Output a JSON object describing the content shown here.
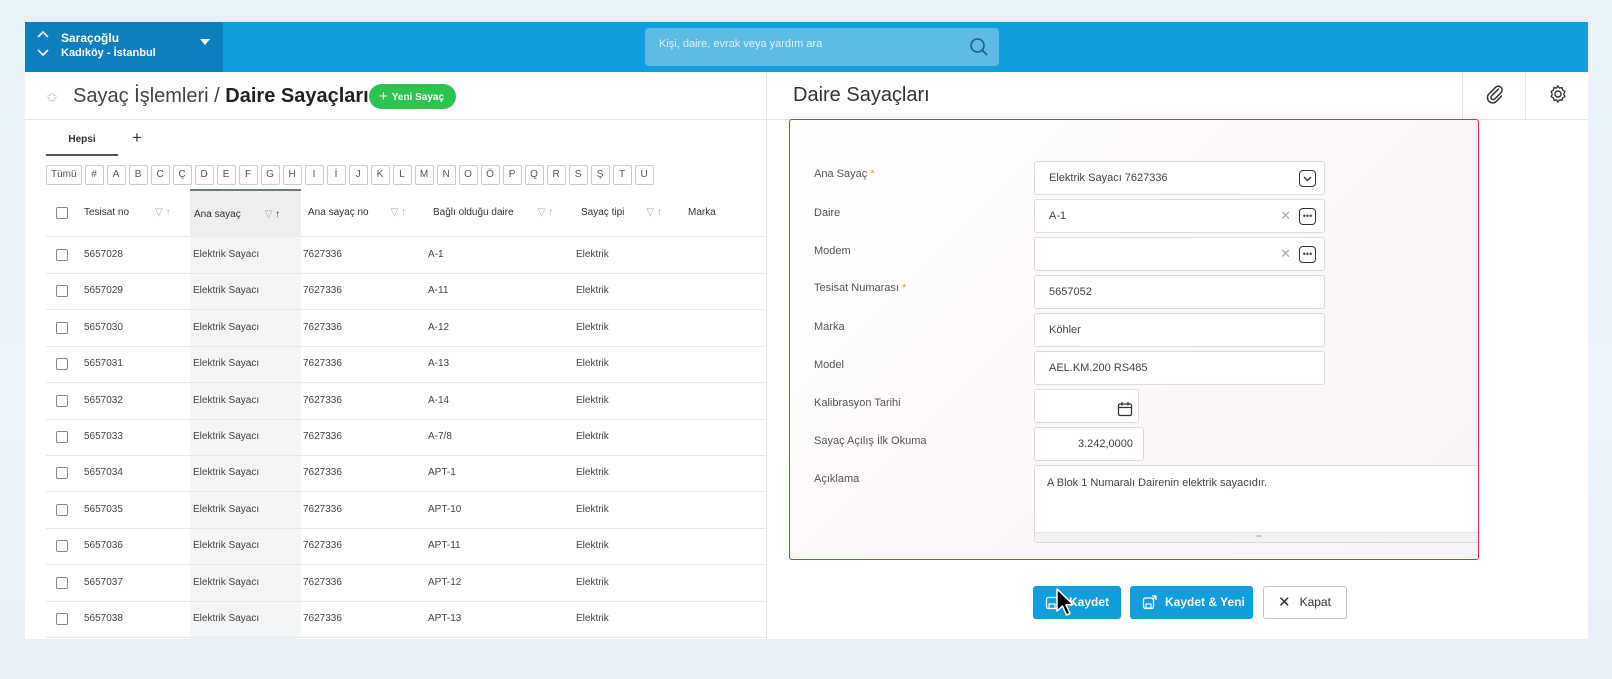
{
  "site": {
    "name": "Saraçoğlu",
    "location": "Kadıköy - İstanbul"
  },
  "search": {
    "placeholder": "Kişi, daire, evrak veya yardım ara"
  },
  "breadcrumb": {
    "parent": "Sayaç İşlemleri /",
    "current": "Daire Sayaçları"
  },
  "new_button": {
    "label": "Yeni Sayaç"
  },
  "tabs": {
    "all": "Hepsi",
    "add": "+"
  },
  "letters": [
    "Tümü",
    "#",
    "A",
    "B",
    "C",
    "Ç",
    "D",
    "E",
    "F",
    "G",
    "H",
    "I",
    "İ",
    "J",
    "K",
    "L",
    "M",
    "N",
    "O",
    "Ö",
    "P",
    "Q",
    "R",
    "S",
    "Ş",
    "T",
    "U"
  ],
  "grid": {
    "columns": [
      "Tesisat no",
      "Ana sayaç",
      "Ana sayaç no",
      "Bağlı olduğu daire",
      "Sayaç tipi",
      "Marka"
    ],
    "rows": [
      {
        "tesisat": "5657028",
        "ana": "Elektrik Sayacı",
        "no": "7627336",
        "daire": "A-1",
        "tip": "Elektrik"
      },
      {
        "tesisat": "5657029",
        "ana": "Elektrik Sayacı",
        "no": "7627336",
        "daire": "A-11",
        "tip": "Elektrik"
      },
      {
        "tesisat": "5657030",
        "ana": "Elektrik Sayacı",
        "no": "7627336",
        "daire": "A-12",
        "tip": "Elektrik"
      },
      {
        "tesisat": "5657031",
        "ana": "Elektrik Sayacı",
        "no": "7627336",
        "daire": "A-13",
        "tip": "Elektrik"
      },
      {
        "tesisat": "5657032",
        "ana": "Elektrik Sayacı",
        "no": "7627336",
        "daire": "A-14",
        "tip": "Elektrik"
      },
      {
        "tesisat": "5657033",
        "ana": "Elektrik Sayacı",
        "no": "7627336",
        "daire": "A-7/8",
        "tip": "Elektrik"
      },
      {
        "tesisat": "5657034",
        "ana": "Elektrik Sayacı",
        "no": "7627336",
        "daire": "APT-1",
        "tip": "Elektrik"
      },
      {
        "tesisat": "5657035",
        "ana": "Elektrik Sayacı",
        "no": "7627336",
        "daire": "APT-10",
        "tip": "Elektrik"
      },
      {
        "tesisat": "5657036",
        "ana": "Elektrik Sayacı",
        "no": "7627336",
        "daire": "APT-11",
        "tip": "Elektrik"
      },
      {
        "tesisat": "5657037",
        "ana": "Elektrik Sayacı",
        "no": "7627336",
        "daire": "APT-12",
        "tip": "Elektrik"
      },
      {
        "tesisat": "5657038",
        "ana": "Elektrik Sayacı",
        "no": "7627336",
        "daire": "APT-13",
        "tip": "Elektrik"
      }
    ]
  },
  "panel": {
    "title": "Daire Sayaçları",
    "form": {
      "ana_sayac": {
        "label": "Ana Sayaç",
        "value": "Elektrik Sayacı 7627336"
      },
      "daire": {
        "label": "Daire",
        "value": "A-1"
      },
      "modem": {
        "label": "Modem",
        "value": ""
      },
      "tesisat": {
        "label": "Tesisat Numarası",
        "value": "5657052"
      },
      "marka": {
        "label": "Marka",
        "value": "Köhler"
      },
      "model": {
        "label": "Model",
        "value": "AEL.KM.200 RS485"
      },
      "kalibrasyon": {
        "label": "Kalibrasyon Tarihi",
        "value": ""
      },
      "ilk_okuma": {
        "label": "Sayaç Açılış İlk Okuma",
        "value": "3.242,0000"
      },
      "aciklama": {
        "label": "Açıklama",
        "value": "A Blok 1 Numaralı Dairenin elektrik sayacıdır."
      }
    },
    "actions": {
      "save": "Kaydet",
      "save_new": "Kaydet & Yeni",
      "close": "Kapat"
    }
  },
  "colors": {
    "topbar": "#119edc",
    "site_block": "#0d7fbf",
    "green": "#2cc34e",
    "form_border": "#d8323f"
  }
}
